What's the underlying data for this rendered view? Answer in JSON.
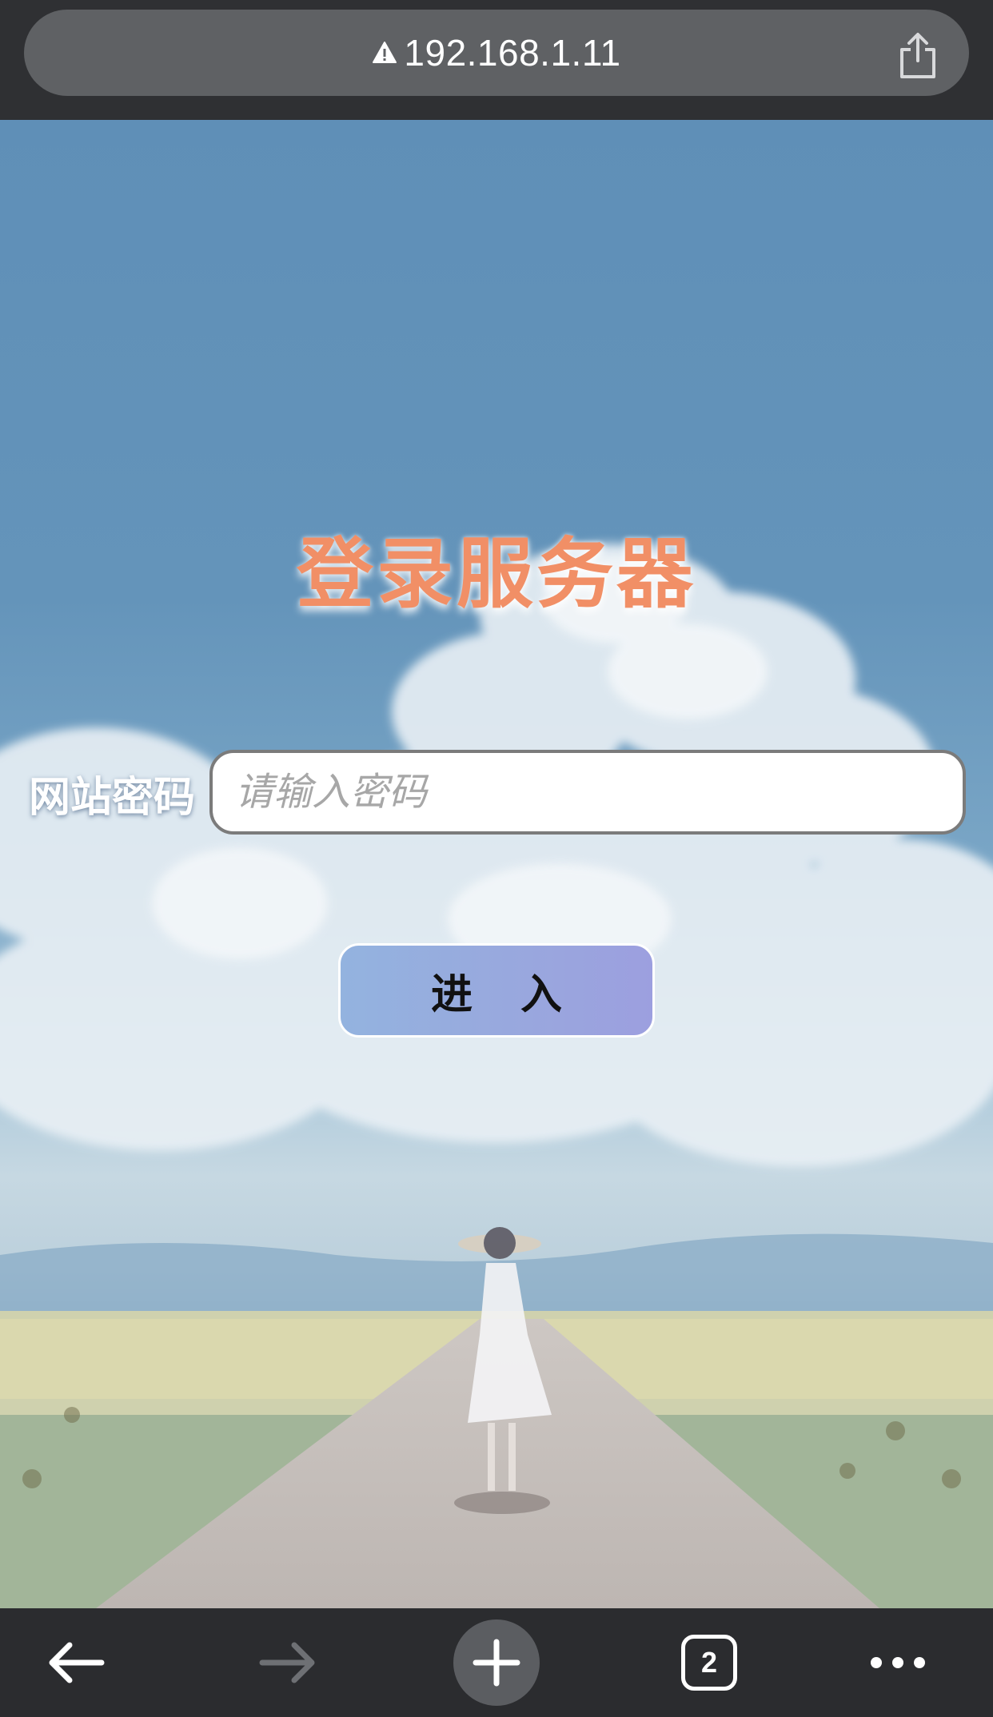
{
  "browser": {
    "url": "192.168.1.11",
    "icons": {
      "security": "warning-triangle-icon",
      "share": "share-icon",
      "back": "arrow-left-icon",
      "forward": "arrow-right-icon",
      "new_tab": "plus-icon",
      "more": "ellipsis-icon"
    },
    "tab_count": "2"
  },
  "login": {
    "title": "登录服务器",
    "password_label": "网站密码",
    "password_value": "",
    "password_placeholder": "请输入密码",
    "submit_label": "进入"
  },
  "colors": {
    "title": "#f18f66",
    "button_gradient_start": "#93b3df",
    "button_gradient_end": "#9c9fdf",
    "toolbar": "#2b2c2f",
    "urlbar": "#5f6164"
  }
}
